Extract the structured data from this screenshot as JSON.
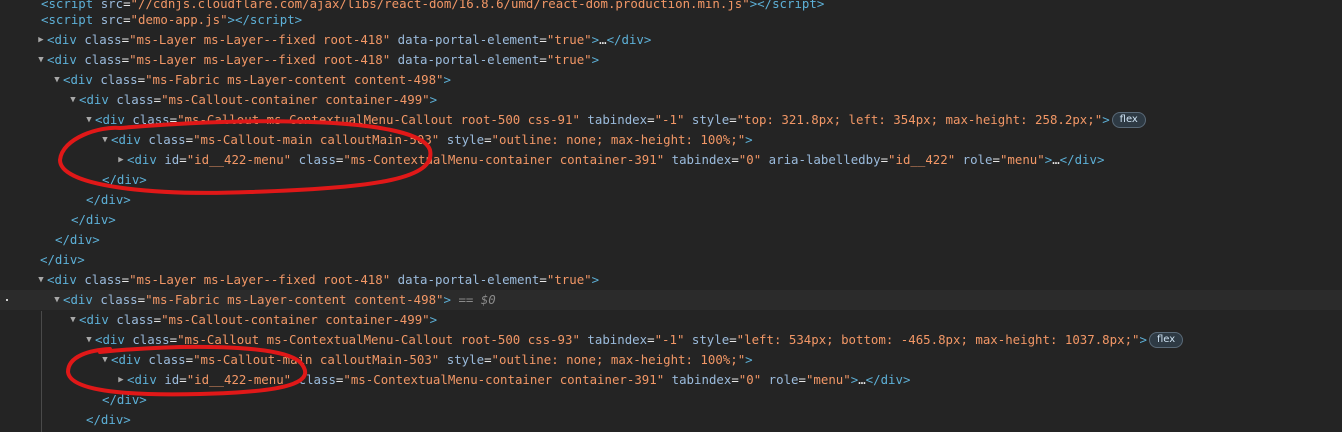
{
  "colors": {
    "background": "#242424",
    "tag": "#5db0d7",
    "attr_name": "#9bbbdc",
    "attr_value": "#f29766",
    "annotation": "#e01818"
  },
  "lines": [
    {
      "tri": "",
      "html": "<span class=\"tag\">&lt;script</span> <span class=\"an\">src</span>=<span class=\"av\">\"//cdnjs.cloudflare.com/ajax/libs/react-dom/16.8.6/umd/react-dom.production.min.js\"</span><span class=\"tag\">&gt;&lt;/script&gt;</span>"
    },
    {
      "tri": "",
      "html": "<span class=\"tag\">&lt;script</span> <span class=\"an\">src</span>=<span class=\"av\">\"demo-app.js\"</span><span class=\"tag\">&gt;&lt;/script&gt;</span>"
    },
    {
      "tri": "right",
      "html": "<span class=\"tag\">&lt;div</span> <span class=\"an\">class</span>=<span class=\"av\">\"ms-Layer ms-Layer--fixed root-418\"</span> <span class=\"an\">data-portal-element</span>=<span class=\"av\">\"true\"</span><span class=\"tag\">&gt;</span><span class=\"txt\">…</span><span class=\"tag\">&lt;/div&gt;</span>"
    },
    {
      "tri": "down",
      "html": "<span class=\"tag\">&lt;div</span> <span class=\"an\">class</span>=<span class=\"av\">\"ms-Layer ms-Layer--fixed root-418\"</span> <span class=\"an\">data-portal-element</span>=<span class=\"av\">\"true\"</span><span class=\"tag\">&gt;</span>"
    },
    {
      "tri": "down",
      "html": "<span class=\"tag\">&lt;div</span> <span class=\"an\">class</span>=<span class=\"av\">\"ms-Fabric ms-Layer-content content-498\"</span><span class=\"tag\">&gt;</span>"
    },
    {
      "tri": "down",
      "html": "<span class=\"tag\">&lt;div</span> <span class=\"an\">class</span>=<span class=\"av\">\"ms-Callout-container container-499\"</span><span class=\"tag\">&gt;</span>"
    },
    {
      "tri": "down",
      "html": "<span class=\"tag\">&lt;div</span> <span class=\"an\">class</span>=<span class=\"av\">\"ms-Callout ms-ContextualMenu-Callout root-500 css-91\"</span> <span class=\"an\">tabindex</span>=<span class=\"av\">\"-1\"</span> <span class=\"an\">style</span>=<span class=\"av\">\"top: 321.8px; left: 354px; max-height: 258.2px;\"</span><span class=\"tag\">&gt;</span>",
      "badge": "flex"
    },
    {
      "tri": "down",
      "html": "<span class=\"tag\">&lt;div</span> <span class=\"an\">class</span>=<span class=\"av\">\"ms-Callout-main calloutMain-503\"</span> <span class=\"an\">style</span>=<span class=\"av\">\"outline: none; max-height: 100%;\"</span><span class=\"tag\">&gt;</span>"
    },
    {
      "tri": "right",
      "html": "<span class=\"tag\">&lt;div</span> <span class=\"an\">id</span>=<span class=\"av\">\"id__422-menu\"</span> <span class=\"an\">class</span>=<span class=\"av\">\"ms-ContextualMenu-container container-391\"</span> <span class=\"an\">tabindex</span>=<span class=\"av\">\"0\"</span> <span class=\"an\">aria-labelledby</span>=<span class=\"av\">\"id__422\"</span> <span class=\"an\">role</span>=<span class=\"av\">\"menu\"</span><span class=\"tag\">&gt;</span><span class=\"txt\">…</span><span class=\"tag\">&lt;/div&gt;</span>"
    },
    {
      "tri": "",
      "html": "<span class=\"tag\">&lt;/div&gt;</span>"
    },
    {
      "tri": "",
      "html": "<span class=\"tag\">&lt;/div&gt;</span>"
    },
    {
      "tri": "",
      "html": "<span class=\"tag\">&lt;/div&gt;</span>"
    },
    {
      "tri": "",
      "html": "<span class=\"tag\">&lt;/div&gt;</span>"
    },
    {
      "tri": "",
      "html": "<span class=\"tag\">&lt;/div&gt;</span>"
    },
    {
      "tri": "down",
      "html": "<span class=\"tag\">&lt;div</span> <span class=\"an\">class</span>=<span class=\"av\">\"ms-Layer ms-Layer--fixed root-418\"</span> <span class=\"an\">data-portal-element</span>=<span class=\"av\">\"true\"</span><span class=\"tag\">&gt;</span>"
    },
    {
      "tri": "down",
      "html": "<span class=\"tag\">&lt;div</span> <span class=\"an\">class</span>=<span class=\"av\">\"ms-Fabric ms-Layer-content content-498\"</span><span class=\"tag\">&gt;</span> <span class=\"dim\">== $0</span>"
    },
    {
      "tri": "down",
      "html": "<span class=\"tag\">&lt;div</span> <span class=\"an\">class</span>=<span class=\"av\">\"ms-Callout-container container-499\"</span><span class=\"tag\">&gt;</span>"
    },
    {
      "tri": "down",
      "html": "<span class=\"tag\">&lt;div</span> <span class=\"an\">class</span>=<span class=\"av\">\"ms-Callout ms-ContextualMenu-Callout root-500 css-93\"</span> <span class=\"an\">tabindex</span>=<span class=\"av\">\"-1\"</span> <span class=\"an\">style</span>=<span class=\"av\">\"left: 534px; bottom: -465.8px; max-height: 1037.8px;\"</span><span class=\"tag\">&gt;</span>",
      "badge": "flex"
    },
    {
      "tri": "down",
      "html": "<span class=\"tag\">&lt;div</span> <span class=\"an\">class</span>=<span class=\"av\">\"ms-Callout-main calloutMain-503\"</span> <span class=\"an\">style</span>=<span class=\"av\">\"outline: none; max-height: 100%;\"</span><span class=\"tag\">&gt;</span>"
    },
    {
      "tri": "right",
      "html": "<span class=\"tag\">&lt;div</span> <span class=\"an\">id</span>=<span class=\"av\">\"id__422-menu\"</span> <span class=\"an\">class</span>=<span class=\"av\">\"ms-ContextualMenu-container container-391\"</span> <span class=\"an\">tabindex</span>=<span class=\"av\">\"0\"</span> <span class=\"an\">role</span>=<span class=\"av\">\"menu\"</span><span class=\"tag\">&gt;</span><span class=\"txt\">…</span><span class=\"tag\">&lt;/div&gt;</span>"
    },
    {
      "tri": "",
      "html": "<span class=\"tag\">&lt;/div&gt;</span>"
    },
    {
      "tri": "",
      "html": "<span class=\"tag\">&lt;/div&gt;</span>"
    }
  ]
}
